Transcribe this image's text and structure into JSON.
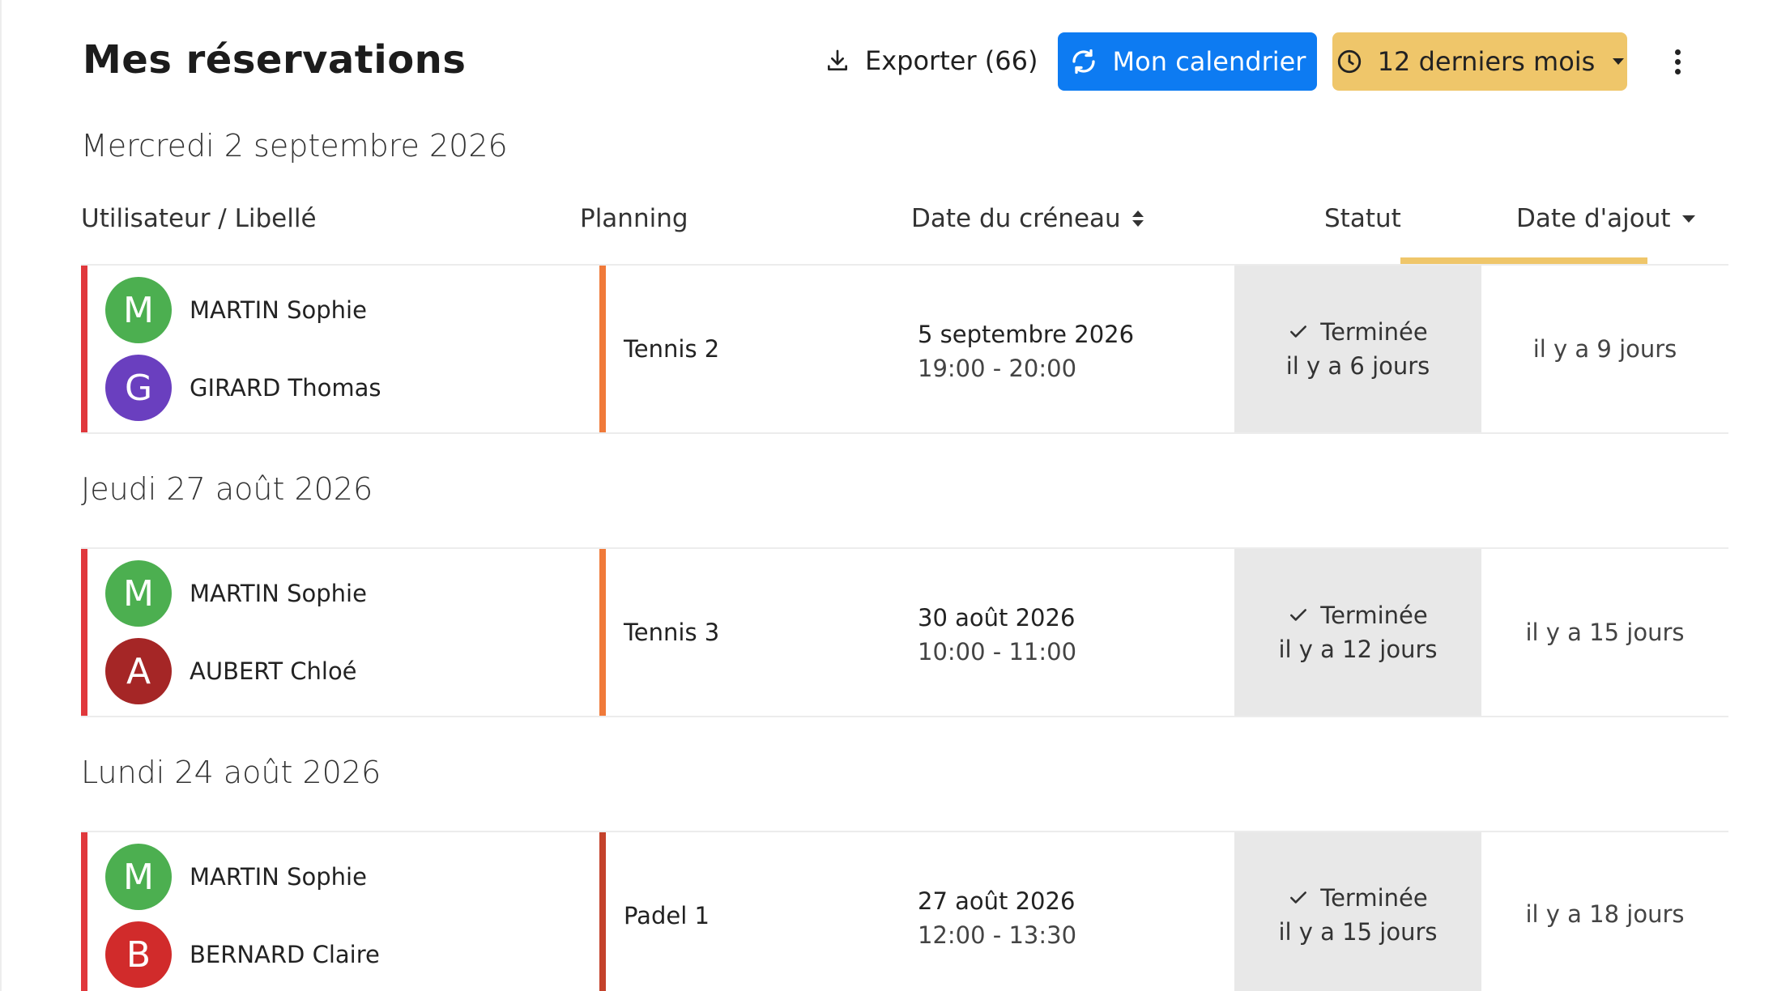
{
  "header": {
    "title": "Mes réservations",
    "export_label": "Exporter (66)",
    "calendar_label": "Mon calendrier",
    "period_label": "12 derniers mois"
  },
  "columns": {
    "user": "Utilisateur / Libellé",
    "planning": "Planning",
    "slot_date": "Date du créneau",
    "status": "Statut",
    "added_date": "Date d'ajout"
  },
  "groups": [
    {
      "day": "Mercredi 2 septembre 2026",
      "users": [
        {
          "initial": "M",
          "name": "MARTIN Sophie",
          "color": "#4caf50"
        },
        {
          "initial": "G",
          "name": "GIRARD Thomas",
          "color": "#6a3fbf"
        }
      ],
      "planning": "Tennis 2",
      "planning_color": "#f07a3a",
      "slot_date": "5 septembre 2026",
      "slot_time": "19:00 - 20:00",
      "status": "Terminée",
      "status_since": "il y a 6 jours",
      "added": "il y a 9 jours"
    },
    {
      "day": "Jeudi 27 août 2026",
      "users": [
        {
          "initial": "M",
          "name": "MARTIN Sophie",
          "color": "#4caf50"
        },
        {
          "initial": "A",
          "name": "AUBERT Chloé",
          "color": "#a52626"
        }
      ],
      "planning": "Tennis 3",
      "planning_color": "#f07a3a",
      "slot_date": "30 août 2026",
      "slot_time": "10:00 - 11:00",
      "status": "Terminée",
      "status_since": "il y a 12 jours",
      "added": "il y a 15 jours"
    },
    {
      "day": "Lundi 24 août 2026",
      "users": [
        {
          "initial": "M",
          "name": "MARTIN Sophie",
          "color": "#4caf50"
        },
        {
          "initial": "B",
          "name": "BERNARD Claire",
          "color": "#d12b2b"
        }
      ],
      "planning": "Padel 1",
      "planning_color": "#c4422b",
      "slot_date": "27 août 2026",
      "slot_time": "12:00 - 13:30",
      "status": "Terminée",
      "status_since": "il y a 15 jours",
      "added": "il y a 18 jours"
    }
  ],
  "colors": {
    "primary": "#0d7bf2",
    "period": "#efc66a",
    "user_bar": "#e0383c",
    "status_bg": "#e8e8e8"
  }
}
